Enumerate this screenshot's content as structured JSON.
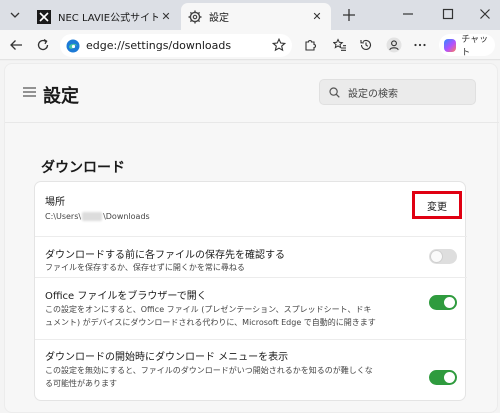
{
  "browser": {
    "tabs": [
      {
        "title": "NEC LAVIE公式サイト > サー",
        "active": false
      },
      {
        "title": "設定",
        "active": true
      }
    ],
    "address": "edge://settings/downloads",
    "copilot_label": "チャット"
  },
  "settings": {
    "page_title": "設定",
    "search_placeholder": "設定の検索",
    "section_title": "ダウンロード",
    "location": {
      "label": "場所",
      "path_prefix": "C:\\Users\\",
      "path_suffix": "\\Downloads",
      "change_button": "変更"
    },
    "ask_before_download": {
      "label": "ダウンロードする前に各ファイルの保存先を確認する",
      "description": "ファイルを保存するか、保存せずに開くかを常に尋ねる",
      "enabled": false
    },
    "open_office_in_browser": {
      "label": "Office ファイルをブラウザーで開く",
      "description_line1": "この設定をオンにすると、Office ファイル (プレゼンテーション、スプレッドシート、ドキ",
      "description_line2": "ュメント) がデバイスにダウンロードされる代わりに、Microsoft Edge で自動的に開きます",
      "enabled": true
    },
    "show_download_menu": {
      "label": "ダウンロードの開始時にダウンロード メニューを表示",
      "description_line1": "この設定を無効にすると、ファイルのダウンロードがいつ開始されるかを知るのが難しくな",
      "description_line2": "る可能性があります",
      "enabled": true
    }
  },
  "colors": {
    "toggle_on": "#2f9b3e",
    "highlight": "#e00012"
  }
}
